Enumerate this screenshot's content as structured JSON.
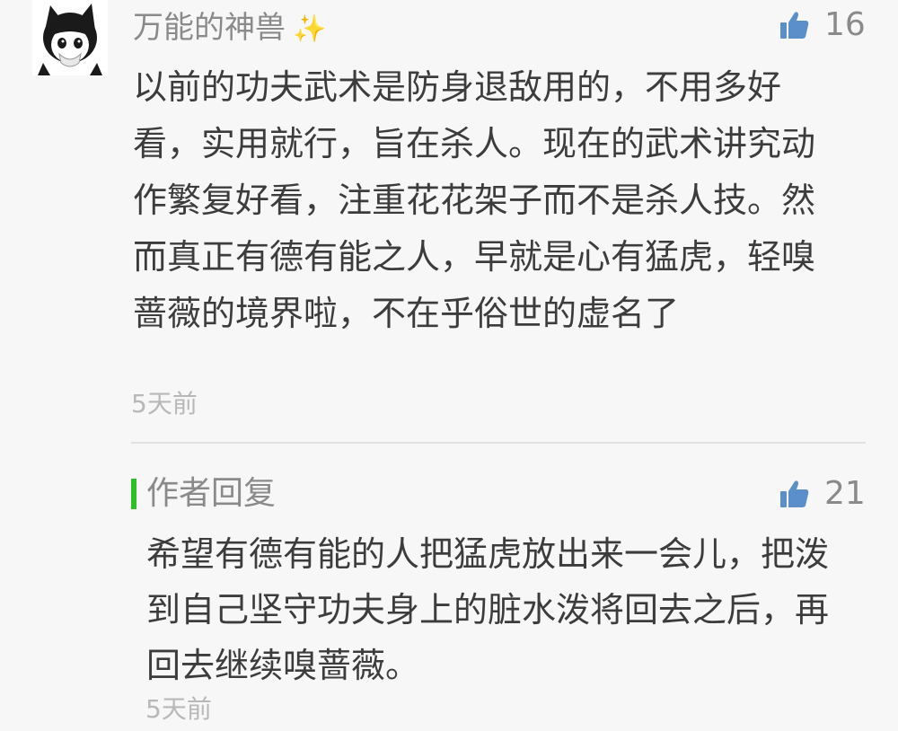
{
  "comment": {
    "nickname": "万能的神兽",
    "nickname_emoji": "✨",
    "likes": "16",
    "text": "以前的功夫武术是防身退敌用的，不用多好看，实用就行，旨在杀人。现在的武术讲究动作繁复好看，注重花花架子而不是杀人技。然而真正有德有能之人，早就是心有猛虎，轻嗅蔷薇的境界啦，不在乎俗世的虚名了",
    "time": "5天前"
  },
  "reply": {
    "label": "作者回复",
    "likes": "21",
    "text": "希望有德有能的人把猛虎放出来一会儿，把泼到自己坚守功夫身上的脏水泼将回去之后，再回去继续嗅蔷薇。",
    "time": "5天前"
  },
  "colors": {
    "accent_green": "#2fbf26",
    "like_blue": "#5b8fc9",
    "muted_text": "#8a8a8a",
    "body_text": "#3c3c3c"
  },
  "icons": {
    "like": "thumbs-up-icon",
    "emoji": "sparkles-icon"
  }
}
